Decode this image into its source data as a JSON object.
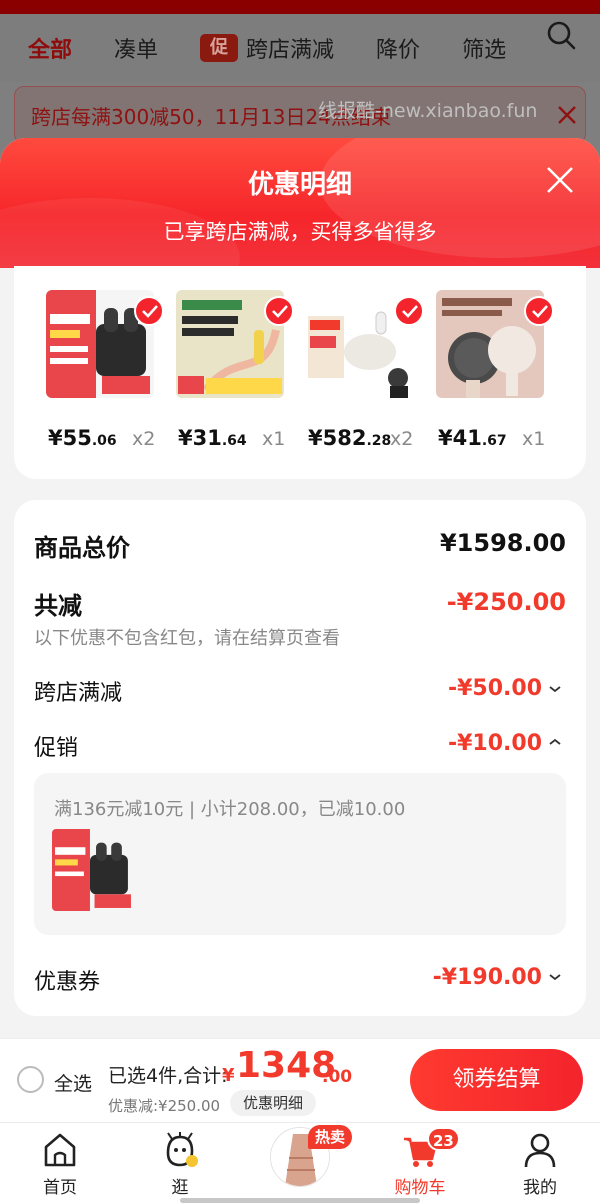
{
  "background": {
    "tabs": [
      {
        "label": "全部",
        "active": true
      },
      {
        "label": "凑单",
        "active": false
      },
      {
        "label": "跨店满减",
        "badge": "促",
        "active": false
      },
      {
        "label": "降价",
        "active": false
      },
      {
        "label": "筛选",
        "active": false
      }
    ],
    "banner_text": "跨店每满300减50，11月13日24点结束",
    "watermark": "线报酷-new.xianbao.fun"
  },
  "sheet": {
    "title": "优惠明细",
    "subtitle": "已享跨店满减，买得多省得多"
  },
  "products": [
    {
      "price_int": "¥55",
      "price_dec": ".06",
      "qty": "x2",
      "color": "#e8464a"
    },
    {
      "price_int": "¥31",
      "price_dec": ".64",
      "qty": "x1",
      "color": "#e9e4c8"
    },
    {
      "price_int": "¥582",
      "price_dec": ".28",
      "qty": "x2",
      "color": "#f2efe9"
    },
    {
      "price_int": "¥41",
      "price_dec": ".67",
      "qty": "x1",
      "color": "#e4c8bd"
    }
  ],
  "detail": {
    "total_label": "商品总价",
    "total_value": "¥1598.00",
    "reduce_label": "共减",
    "reduce_value": "-¥250.00",
    "reduce_note": "以下优惠不包含红包，请在结算页查看",
    "cross_label": "跨店满减",
    "cross_value": "-¥50.00",
    "promo_label": "促销",
    "promo_value": "-¥10.00",
    "promo_rule": "满136元减10元 | 小计208.00，已减10.00",
    "coupon_label": "优惠券",
    "coupon_value": "-¥190.00"
  },
  "checkout": {
    "select_all": "全选",
    "selected_text": "已选4件,合计:",
    "currency": "¥",
    "amount_int": "1348",
    "amount_dec": ".00",
    "saved_text": "优惠减:¥250.00",
    "detail_chip": "优惠明细",
    "pay_button": "领券结算"
  },
  "tabbar": {
    "items": [
      {
        "label": "首页",
        "icon": "home-icon"
      },
      {
        "label": "逛",
        "icon": "browse-icon"
      },
      {
        "label": "",
        "icon": "hot-product-icon"
      },
      {
        "label": "购物车",
        "icon": "cart-icon",
        "active": true
      },
      {
        "label": "我的",
        "icon": "profile-icon"
      }
    ],
    "hot_badge": "热卖",
    "cart_count": "23"
  },
  "colors": {
    "accent": "#f13a2c",
    "header_gradient_start": "#ff4a3e",
    "header_gradient_end": "#f3303a"
  }
}
